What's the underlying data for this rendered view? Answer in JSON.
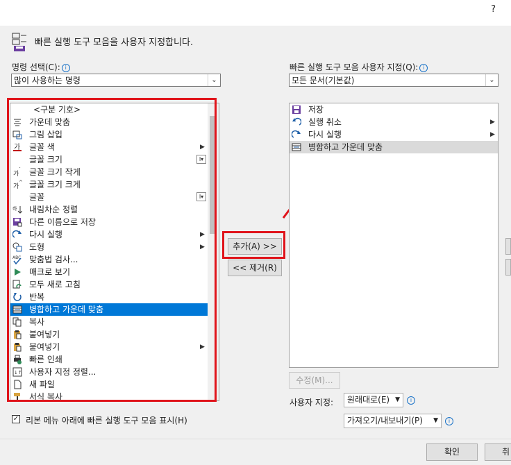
{
  "help_label": "?",
  "header": {
    "title": "빠른 실행 도구 모음을 사용자 지정합니다."
  },
  "left": {
    "label": "명령 선택(C):",
    "dropdown_value": "많이 사용하는 명령",
    "items": [
      {
        "label": "<구분 기호>",
        "icon": "separator"
      },
      {
        "label": "가운데 맞춤",
        "icon": "align-center-icon"
      },
      {
        "label": "그림 삽입",
        "icon": "insert-picture-icon"
      },
      {
        "label": "글꼴 색",
        "icon": "font-color-icon"
      },
      {
        "label": "글꼴 크기",
        "icon": ""
      },
      {
        "label": "글꼴 크기 작게",
        "icon": "font-size-decrease-icon"
      },
      {
        "label": "글꼴 크기 크게",
        "icon": "font-size-increase-icon"
      },
      {
        "label": "글꼴",
        "icon": ""
      },
      {
        "label": "내림차순 정렬",
        "icon": "sort-descending-icon"
      },
      {
        "label": "다른 이름으로 저장",
        "icon": "save-as-icon"
      },
      {
        "label": "다시 실행",
        "icon": "redo-icon"
      },
      {
        "label": "도형",
        "icon": "shapes-icon"
      },
      {
        "label": "맞춤법 검사...",
        "icon": "spelling-icon"
      },
      {
        "label": "매크로 보기",
        "icon": "macro-icon"
      },
      {
        "label": "모두 새로 고침",
        "icon": "refresh-all-icon"
      },
      {
        "label": "반복",
        "icon": "repeat-icon"
      },
      {
        "label": "병합하고 가운데 맞춤",
        "icon": "merge-center-icon"
      },
      {
        "label": "복사",
        "icon": "copy-icon"
      },
      {
        "label": "붙여넣기",
        "icon": "paste-icon"
      },
      {
        "label": "붙여넣기",
        "icon": "paste-icon"
      },
      {
        "label": "빠른 인쇄",
        "icon": "quick-print-icon"
      },
      {
        "label": "사용자 지정 정렬...",
        "icon": "custom-sort-icon"
      },
      {
        "label": "새 파일",
        "icon": "new-file-icon"
      },
      {
        "label": "서식 복사",
        "icon": "format-painter-icon"
      }
    ],
    "selected_label": "병합하고 가운데 맞춤",
    "show_below_ribbon_label": "리본 메뉴 아래에 빠른 실행 도구 모음 표시(H)"
  },
  "right": {
    "label": "빠른 실행 도구 모음 사용자 지정(Q):",
    "dropdown_value": "모든 문서(기본값)",
    "items": [
      {
        "label": "저장",
        "icon": "save-icon"
      },
      {
        "label": "실행 취소",
        "icon": "undo-icon"
      },
      {
        "label": "다시 실행",
        "icon": "redo-icon"
      },
      {
        "label": "병합하고 가운데 맞춤",
        "icon": "merge-center-icon"
      }
    ],
    "modify_button": "수정(M)...",
    "customize_label": "사용자 지정:",
    "reset_button": "원래대로(E)",
    "import_export_button": "가져오기/내보내기(P)"
  },
  "buttons": {
    "add": "추가(A) >>",
    "remove": "<< 제거(R)",
    "ok": "확인",
    "cancel": "취"
  },
  "colors": {
    "highlight": "#e0141b",
    "selection": "#0078d7"
  }
}
